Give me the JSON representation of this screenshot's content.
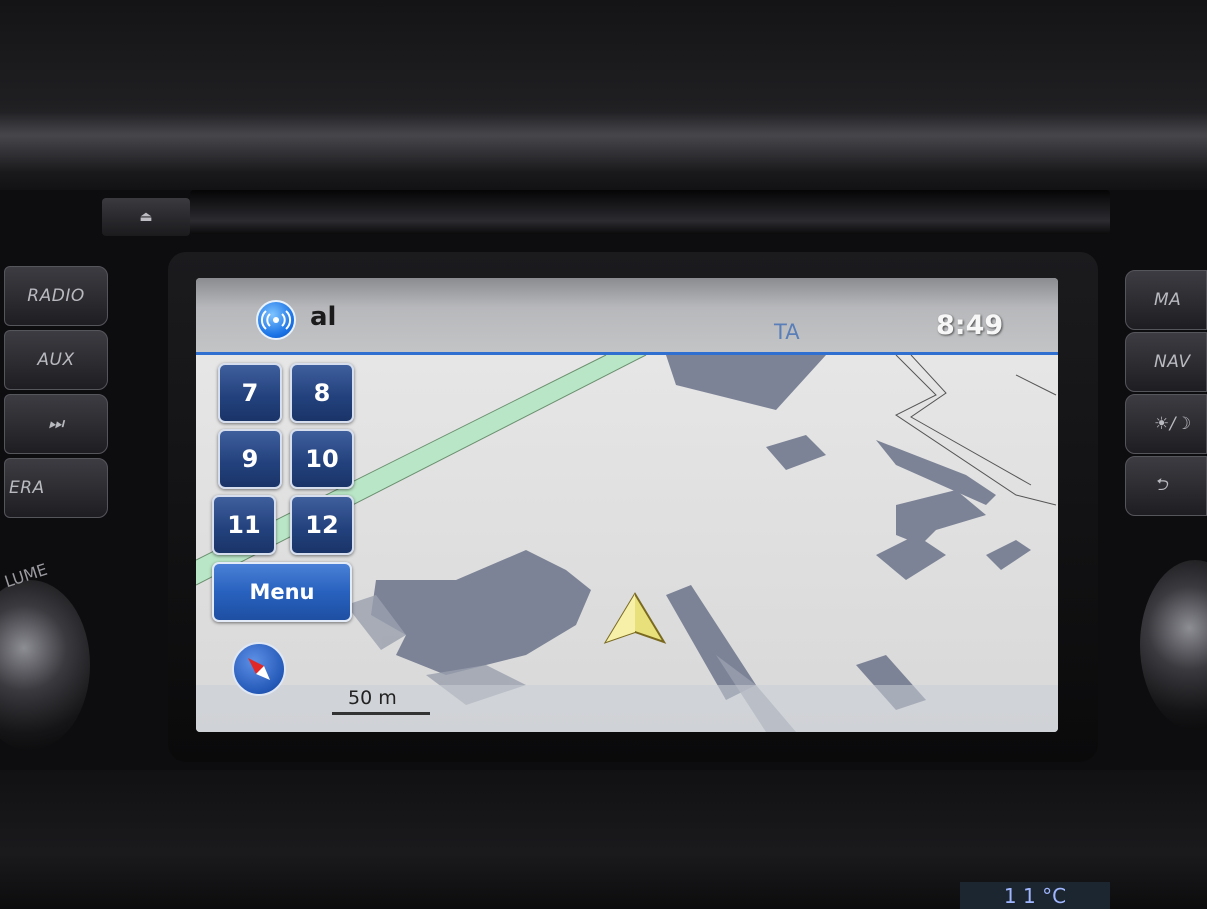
{
  "hardware": {
    "left_buttons": [
      "RADIO",
      "AUX",
      "⏭",
      "ERA"
    ],
    "right_buttons": [
      "MA",
      "NAV",
      "☀/☽",
      "⮌"
    ],
    "volume_label": "LUME",
    "temperature": "1 1 °C"
  },
  "status_bar": {
    "station": "al",
    "ta": "TA",
    "time": "8:49"
  },
  "presets": [
    "7",
    "8",
    "9",
    "10",
    "11",
    "12"
  ],
  "menu_label": "Menu",
  "map": {
    "scale": "50 m",
    "colors": {
      "background": "#dcdcdc",
      "building": "#7c8396",
      "park": "#b9e6c6",
      "position_arrow": "#e8e07a"
    }
  },
  "icons": {
    "radio": "radio-wave-icon",
    "compass": "compass-icon",
    "position": "vehicle-position-arrow-icon"
  }
}
